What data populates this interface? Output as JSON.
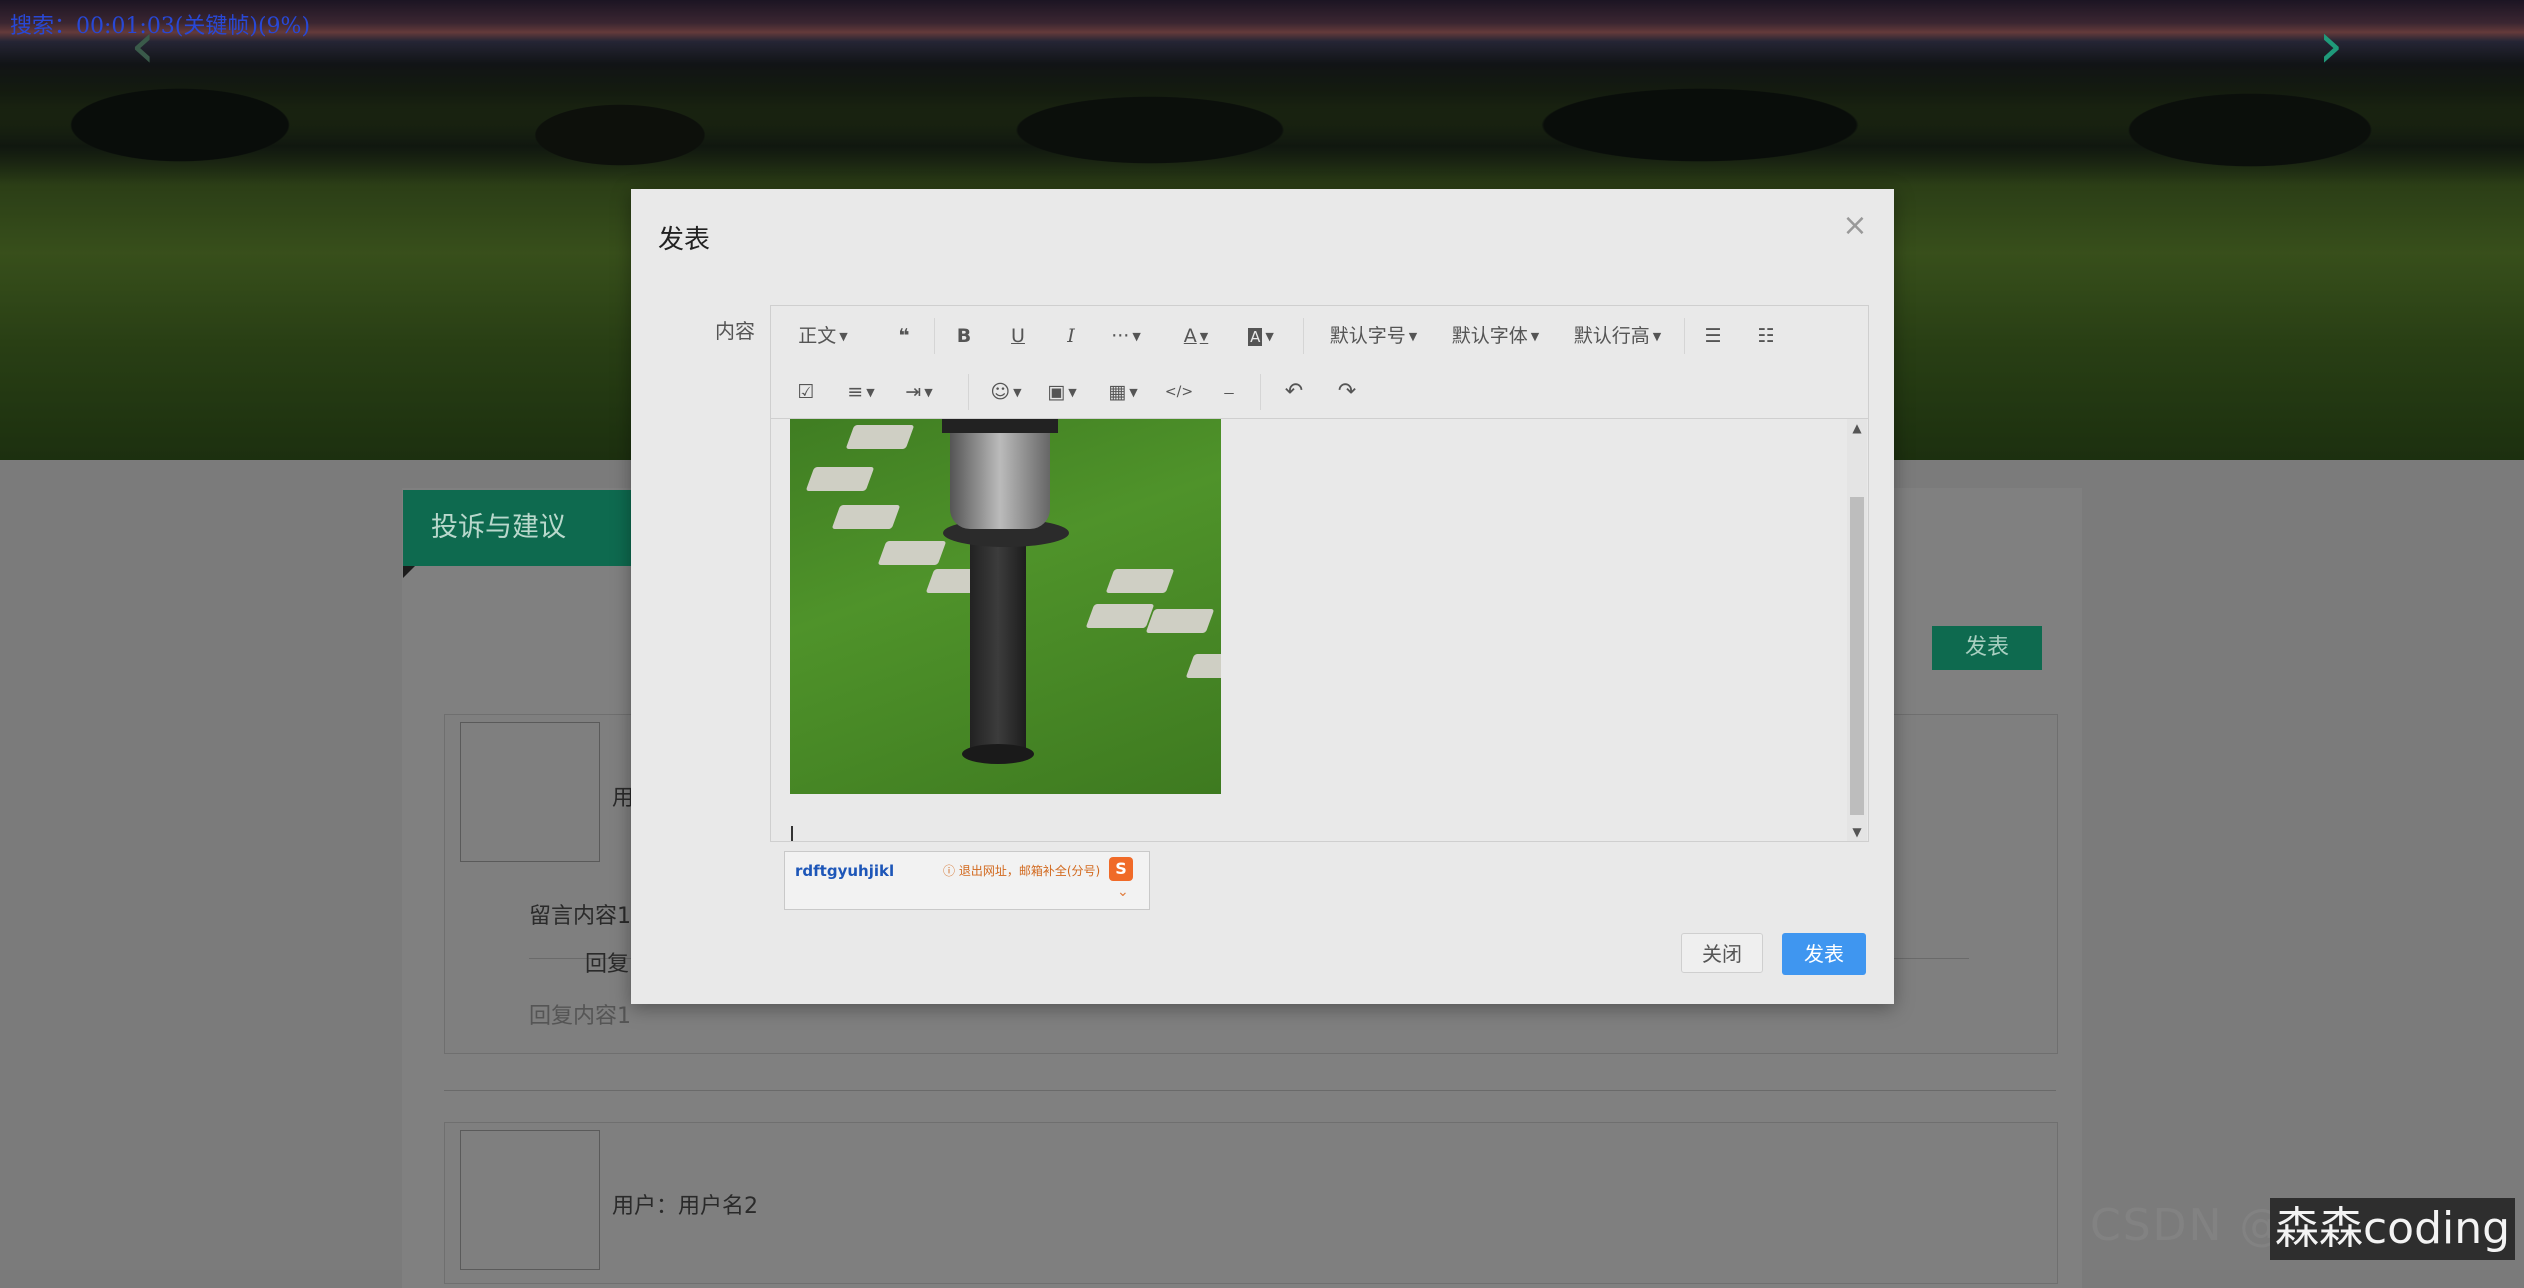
{
  "overlay": {
    "search_status": "搜索：00:01:03(关键帧)(9%)"
  },
  "hero": {
    "prev_glyph": "‹",
    "next_glyph": "›"
  },
  "page": {
    "section_title": "投诉与建议",
    "publish_button": "发表",
    "cards": [
      {
        "user_label": "用",
        "message": "留言内容1",
        "reply_label": "回复",
        "reply_content": "回复内容1"
      },
      {
        "user_label": "用户：用户名2"
      }
    ]
  },
  "watermark": {
    "text": "森森coding",
    "blurred": "CSDN @"
  },
  "modal": {
    "title": "发表",
    "close_glyph": "×",
    "field_label": "内容",
    "toolbar": {
      "paragraph": "正文",
      "quote": "❝",
      "bold": "B",
      "underline": "U",
      "italic": "I",
      "more": "···",
      "font_color": "A",
      "bg_color": "A",
      "font_size": "默认字号",
      "font_family": "默认字体",
      "line_height": "默认行高",
      "bullet_list": "☰",
      "ordered_list": "☷",
      "todo": "☑",
      "align": "≡",
      "indent": "⇥",
      "emoji": "☺",
      "image": "▣",
      "table": "▦",
      "code": "</>",
      "divider": "⎯",
      "undo": "↶",
      "redo": "↷"
    },
    "ime": {
      "input": "rdftgyuhjikl",
      "hint": "ⓘ 退出网址，邮箱补全(分号)",
      "logo": "S",
      "chevron": "⌄"
    },
    "buttons": {
      "close": "关闭",
      "publish": "发表"
    }
  }
}
